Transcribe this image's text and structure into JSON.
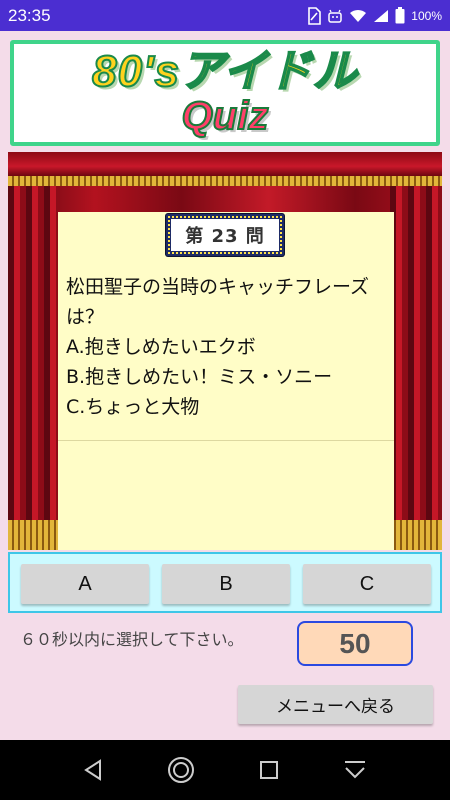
{
  "status_bar": {
    "time": "23:35",
    "battery_percent": "100%",
    "icons": [
      "sim-icon",
      "android-debug-icon",
      "wifi-icon",
      "signal-icon",
      "battery-icon"
    ]
  },
  "banner": {
    "line1": "80'sアイドル",
    "line2": "Quiz"
  },
  "question": {
    "number_label": "第 23 問",
    "text": "松田聖子の当時のキャッチフレーズは？\nA.抱きしめたいエクボ\nB.抱きしめたい！ミス・ソニー\nC.ちょっと大物"
  },
  "answers": {
    "a": "A",
    "b": "B",
    "c": "C"
  },
  "timer": {
    "instruction": "６０秒以内に選択して下さい。",
    "value": "50"
  },
  "menu_button": "メニューへ戻る",
  "colors": {
    "status_bar": "#4b2ed1",
    "background": "#f4dce9",
    "banner_border": "#3fd48a",
    "answer_bar_bg": "#ccfaff",
    "answer_bar_border": "#3ec6e8",
    "timer_bg": "#ffd9b8",
    "timer_border": "#2b4ae0"
  },
  "nav_bar": {
    "icons": [
      "back-icon",
      "home-icon",
      "recents-icon",
      "keyboard-hide-icon"
    ]
  }
}
